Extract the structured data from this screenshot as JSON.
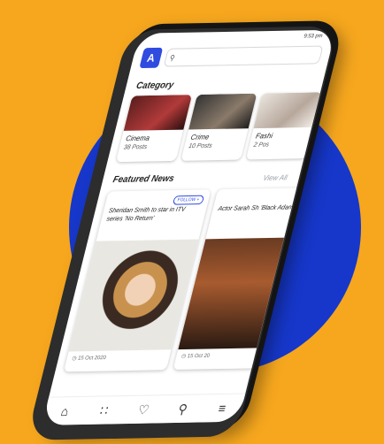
{
  "status_bar": {
    "time": "9:53 pm"
  },
  "app": {
    "logo_letter": "A"
  },
  "search": {
    "placeholder": ""
  },
  "category": {
    "title": "Category",
    "items": [
      {
        "name": "Cinema",
        "count": "38 Posts"
      },
      {
        "name": "Crime",
        "count": "10 Posts"
      },
      {
        "name": "Fashi",
        "count": "2 Pos"
      }
    ]
  },
  "featured": {
    "title": "Featured News",
    "view_all": "View All",
    "items": [
      {
        "headline": "Sheridan Smith to star in ITV series 'No Return'",
        "badge": "FOLLOW +",
        "date": "15 Oct 2020"
      },
      {
        "headline": "Actor Sarah Sh 'Black Adam'",
        "date": "15 Oct 20"
      }
    ]
  },
  "nav": {
    "icons": [
      "home-icon",
      "grid-icon",
      "heart-icon",
      "search-icon",
      "menu-icon"
    ]
  }
}
